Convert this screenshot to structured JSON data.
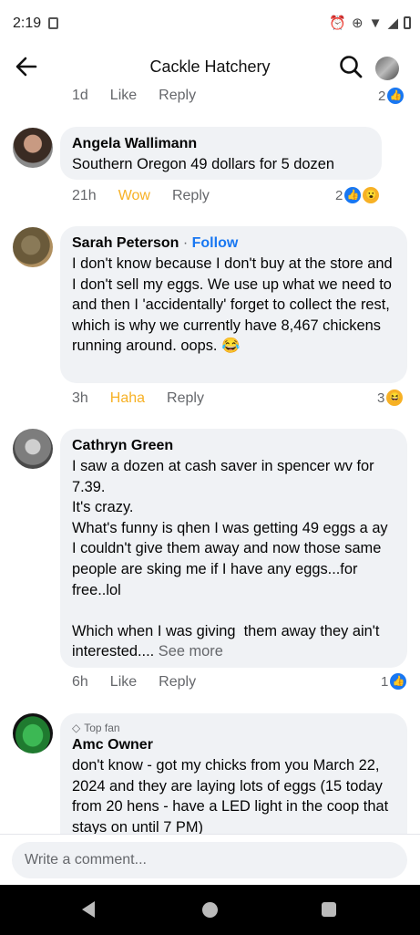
{
  "status_bar": {
    "time": "2:19",
    "icons": [
      "alarm-icon",
      "data-saver-icon",
      "wifi-icon",
      "signal-icon",
      "battery-icon"
    ]
  },
  "app_bar": {
    "title": "Cackle Hatchery"
  },
  "prev_comment": {
    "time": "1d",
    "like_label": "Like",
    "reply_label": "Reply",
    "reaction_count": "2"
  },
  "comments": [
    {
      "name": "Angela Wallimann",
      "text": "Southern Oregon 49 dollars for 5 dozen",
      "time": "21h",
      "reaction_label": "Wow",
      "reply_label": "Reply",
      "reaction_count": "2"
    },
    {
      "name": "Sarah Peterson",
      "separator": "·",
      "follow_label": "Follow",
      "text": "I don't know because I don't buy at the store and I don't sell my eggs. We use up what we need to and then I 'accidentally' forget to collect the rest, which is why we currently have 8,467 chickens running around. oops. 😂",
      "time": "3h",
      "reaction_label": "Haha",
      "reply_label": "Reply",
      "reaction_count": "3"
    },
    {
      "name": "Cathryn Green",
      "text": "I saw a dozen at cash saver in spencer wv for 7.39.\nIt's crazy.\nWhat's funny is qhen I was getting 49 eggs a ay I couldn't give them away and now those same people are sking me if I have any eggs...for free..lol\n\nWhich when I was giving  them away they ain't interested.... ",
      "see_more": "See more",
      "time": "6h",
      "like_label": "Like",
      "reply_label": "Reply",
      "reaction_count": "1"
    },
    {
      "badge": "Top fan",
      "name": "Amc Owner",
      "text": "don't know - got my chicks from you March 22, 2024 and they are laying lots of eggs (15 today from 20 hens - have a LED light in the coop that stays on until 7 PM)"
    }
  ],
  "composer": {
    "placeholder": "Write a comment..."
  },
  "colors": {
    "accent": "#1877f2",
    "bubble": "#f0f2f5",
    "wow": "#f7b125",
    "meta": "#65676b"
  }
}
